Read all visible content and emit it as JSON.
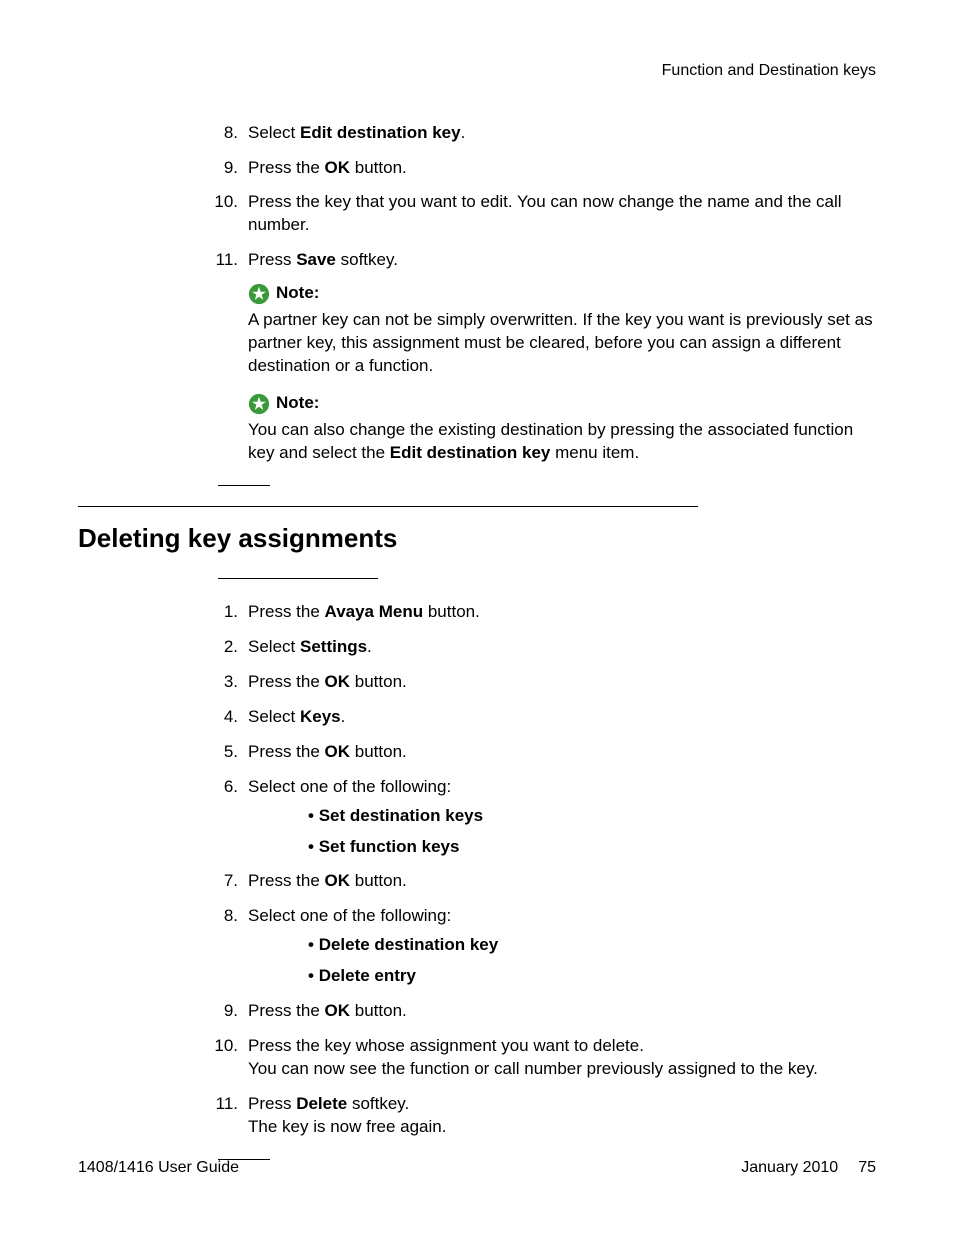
{
  "header": {
    "running": "Function and Destination keys"
  },
  "top_steps": {
    "s8_num": "8.",
    "s8_a": "Select ",
    "s8_b": "Edit destination key",
    "s8_c": ".",
    "s9_num": "9.",
    "s9_a": "Press the ",
    "s9_b": "OK",
    "s9_c": " button.",
    "s10_num": "10.",
    "s10": "Press the key that you want to edit. You can now change the name and the call number.",
    "s11_num": "11.",
    "s11_a": "Press ",
    "s11_b": "Save",
    "s11_c": " softkey."
  },
  "notes": {
    "label": "Note:",
    "n1": "A partner key can not be simply overwritten. If the key you want is previously set as partner key, this assignment must be cleared, before you can assign a different destination or a function.",
    "n2_a": "You can also change the existing destination by pressing the associated function key and select the ",
    "n2_b": "Edit destination key",
    "n2_c": " menu item."
  },
  "section": {
    "title": "Deleting key assignments"
  },
  "steps2": {
    "s1_num": "1.",
    "s1_a": "Press the ",
    "s1_b": "Avaya Menu",
    "s1_c": " button.",
    "s2_num": "2.",
    "s2_a": "Select ",
    "s2_b": "Settings",
    "s2_c": ".",
    "s3_num": "3.",
    "s3_a": "Press the ",
    "s3_b": "OK",
    "s3_c": " button.",
    "s4_num": "4.",
    "s4_a": "Select ",
    "s4_b": "Keys",
    "s4_c": ".",
    "s5_num": "5.",
    "s5_a": "Press the ",
    "s5_b": "OK",
    "s5_c": " button.",
    "s6_num": "6.",
    "s6": "Select one of the following:",
    "s6_opt1": "Set destination keys",
    "s6_opt2": "Set function keys",
    "s7_num": "7.",
    "s7_a": "Press the ",
    "s7_b": "OK",
    "s7_c": " button.",
    "s8_num": "8.",
    "s8": "Select one of the following:",
    "s8_opt1": "Delete destination key",
    "s8_opt2": "Delete entry",
    "s9_num": "9.",
    "s9_a": "Press the ",
    "s9_b": "OK",
    "s9_c": " button.",
    "s10_num": "10.",
    "s10_l1": "Press the key whose assignment you want to delete.",
    "s10_l2": "You can now see the function or call number previously assigned to the key.",
    "s11_num": "11.",
    "s11_a": "Press ",
    "s11_b": "Delete",
    "s11_c": " softkey.",
    "s11_l2": "The key is now free again."
  },
  "footer": {
    "left": "1408/1416 User Guide",
    "date": "January 2010",
    "page": "75"
  }
}
